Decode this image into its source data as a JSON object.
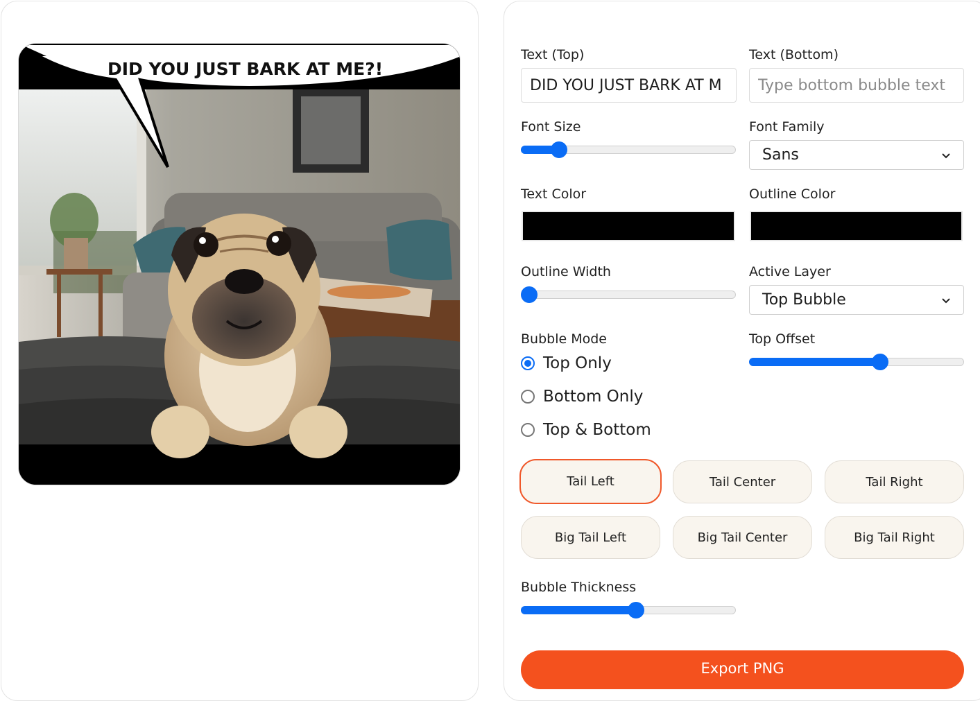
{
  "preview": {
    "top_bubble_text": "DID YOU JUST BARK AT ME?!"
  },
  "controls": {
    "text_top": {
      "label": "Text (Top)",
      "value": "DID YOU JUST BARK AT M"
    },
    "text_bottom": {
      "label": "Text (Bottom)",
      "value": "",
      "placeholder": "Type bottom bubble text"
    },
    "font_size": {
      "label": "Font Size",
      "value_fraction": 0.15
    },
    "font_family": {
      "label": "Font Family",
      "selected": "Sans"
    },
    "text_color": {
      "label": "Text Color",
      "value": "#000000"
    },
    "outline_color": {
      "label": "Outline Color",
      "value": "#000000"
    },
    "outline_width": {
      "label": "Outline Width",
      "value_fraction": 0.0
    },
    "active_layer": {
      "label": "Active Layer",
      "selected": "Top Bubble"
    },
    "bubble_mode": {
      "label": "Bubble Mode",
      "options": [
        "Top Only",
        "Bottom Only",
        "Top & Bottom"
      ],
      "selected": "Top Only"
    },
    "top_offset": {
      "label": "Top Offset",
      "value_fraction": 0.62
    },
    "tail_buttons": [
      "Tail Left",
      "Tail Center",
      "Tail Right",
      "Big Tail Left",
      "Big Tail Center",
      "Big Tail Right"
    ],
    "active_tail": "Tail Left",
    "bubble_thickness": {
      "label": "Bubble Thickness",
      "value_fraction": 0.54
    },
    "export_label": "Export PNG"
  },
  "colors": {
    "accent": "#f4511e",
    "slider_blue": "#0a6cf5",
    "button_bg": "#f9f5ee"
  }
}
